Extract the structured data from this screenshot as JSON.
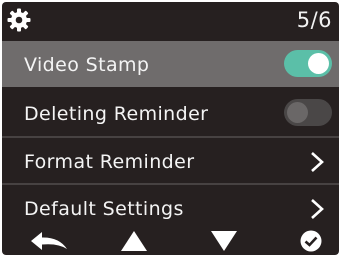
{
  "header": {
    "page_indicator": "5/6",
    "icon": "gear-icon"
  },
  "menu": [
    {
      "label": "Video Stamp",
      "control": "toggle",
      "state": "on",
      "selected": true
    },
    {
      "label": "Deleting Reminder",
      "control": "toggle",
      "state": "off",
      "selected": false
    },
    {
      "label": "Format Reminder",
      "control": "chevron-right-icon",
      "selected": false
    },
    {
      "label": "Default Settings",
      "control": "chevron-right-icon",
      "selected": false
    }
  ],
  "footer": {
    "icons": [
      "back-arrow-icon",
      "up-triangle-icon",
      "down-triangle-icon",
      "confirm-check-icon"
    ]
  },
  "colors": {
    "background": "#262020",
    "selected_row": "#6f6c6c",
    "toggle_on": "#5bbfa8",
    "toggle_off": "#4a4747",
    "text": "#f4f4f4"
  }
}
